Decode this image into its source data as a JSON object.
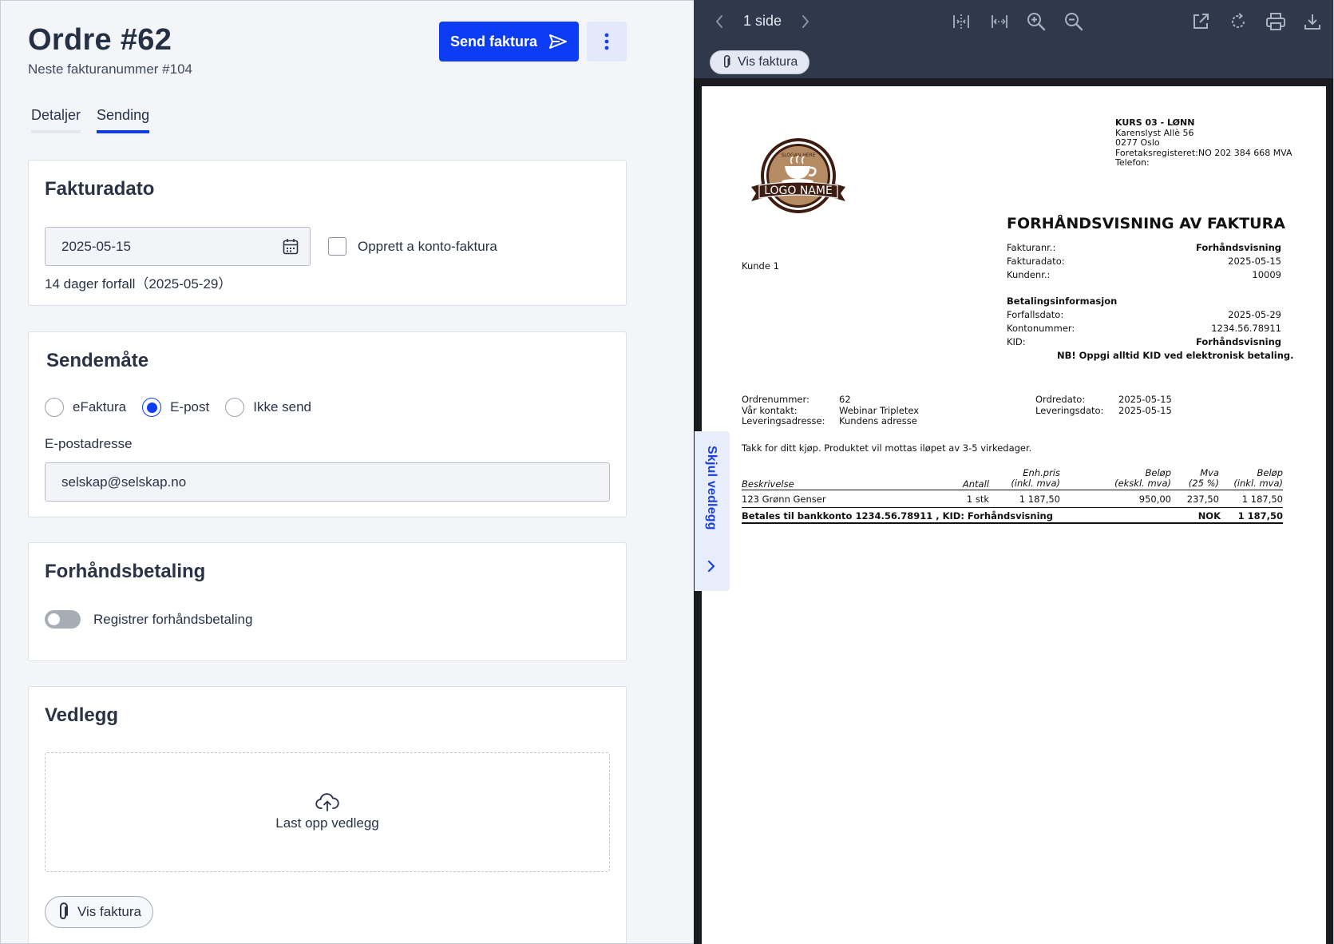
{
  "header": {
    "title": "Ordre #62",
    "next_invoice": "Neste fakturanummer  #104",
    "send_button": "Send faktura"
  },
  "tabs": [
    {
      "label": "Detaljer",
      "active": false
    },
    {
      "label": "Sending",
      "active": true
    }
  ],
  "invoice_date": {
    "heading": "Fakturadato",
    "date_value": "2025-05-15",
    "a_konto_label": "Opprett a konto-faktura",
    "due_text": "14 dager forfall（2025-05-29）"
  },
  "send_method": {
    "heading": "Sendemåte",
    "options": [
      {
        "label": "eFaktura",
        "selected": false
      },
      {
        "label": "E-post",
        "selected": true
      },
      {
        "label": "Ikke send",
        "selected": false
      }
    ],
    "email_label": "E-postadresse",
    "email_value": "selskap@selskap.no"
  },
  "prepayment": {
    "heading": "Forhåndsbetaling",
    "toggle_label": "Registrer forhåndsbetaling",
    "toggle_on": false
  },
  "attachments": {
    "heading": "Vedlegg",
    "upload_label": "Last opp vedlegg",
    "show_invoice_button": "Vis faktura"
  },
  "viewer": {
    "page_count": "1 side",
    "show_invoice_pill": "Vis faktura",
    "side_tab_label": "Skjul vedlegg"
  },
  "invoice_doc": {
    "logo_text": "LOGO NAME",
    "logo_slogan": "SLOGAN HERE",
    "sender_name": "KURS 03 - LØNN",
    "sender_lines": [
      "Karenslyst Allè 56",
      "0277 Oslo",
      "Foretaksregisteret:NO 202 384 668 MVA",
      "Telefon:"
    ],
    "title": "FORHÅNDSVISNING AV FAKTURA",
    "customer": "Kunde 1",
    "fields": [
      {
        "label": "Fakturanr.:",
        "value": "Forhåndsvisning"
      },
      {
        "label": "Fakturadato:",
        "value": "2025-05-15"
      },
      {
        "label": "Kundenr.:",
        "value": "10009"
      }
    ],
    "payment_heading": "Betalingsinformasjon",
    "payment_fields": [
      {
        "label": "Forfallsdato:",
        "value": "2025-05-29"
      },
      {
        "label": "Kontonummer:",
        "value": "1234.56.78911"
      },
      {
        "label": "KID:",
        "value": "Forhåndsvisning"
      }
    ],
    "kid_note": "NB! Oppgi alltid KID ved elektronisk betaling.",
    "meta_left_labels": [
      "Ordrenummer:",
      "Vår kontakt:",
      "Leveringsadresse:"
    ],
    "meta_left_values": [
      "62",
      "Webinar Tripletex",
      "Kundens adresse"
    ],
    "meta_right_labels": [
      "Ordredato:",
      "Leveringsdato:"
    ],
    "meta_right_values": [
      "2025-05-15",
      "2025-05-15"
    ],
    "thanks": "Takk for ditt kjøp. Produktet vil mottas iløpet av 3-5 virkedager.",
    "table_headers": {
      "desc": "Beskrivelse",
      "qty": "Antall",
      "unit_1": "Enh.pris",
      "unit_2": "(inkl. mva)",
      "net_1": "Beløp",
      "net_2": "(ekskl. mva)",
      "vat_1": "Mva",
      "vat_2": "(25 %)",
      "gross_1": "Beløp",
      "gross_2": "(inkl. mva)"
    },
    "rows": [
      {
        "desc": "123 Grønn Genser",
        "qty": "1 stk",
        "unit": "1 187,50",
        "net": "950,00",
        "vat": "237,50",
        "gross": "1 187,50"
      }
    ],
    "total_label": "Betales til bankkonto 1234.56.78911 , KID: Forhåndsvisning",
    "total_currency": "NOK",
    "total_value": "1 187,50"
  },
  "colors": {
    "accent": "#0d3cf5",
    "viewer_toolbar": "#2f394b",
    "page_bg": "#f4f5f9"
  }
}
